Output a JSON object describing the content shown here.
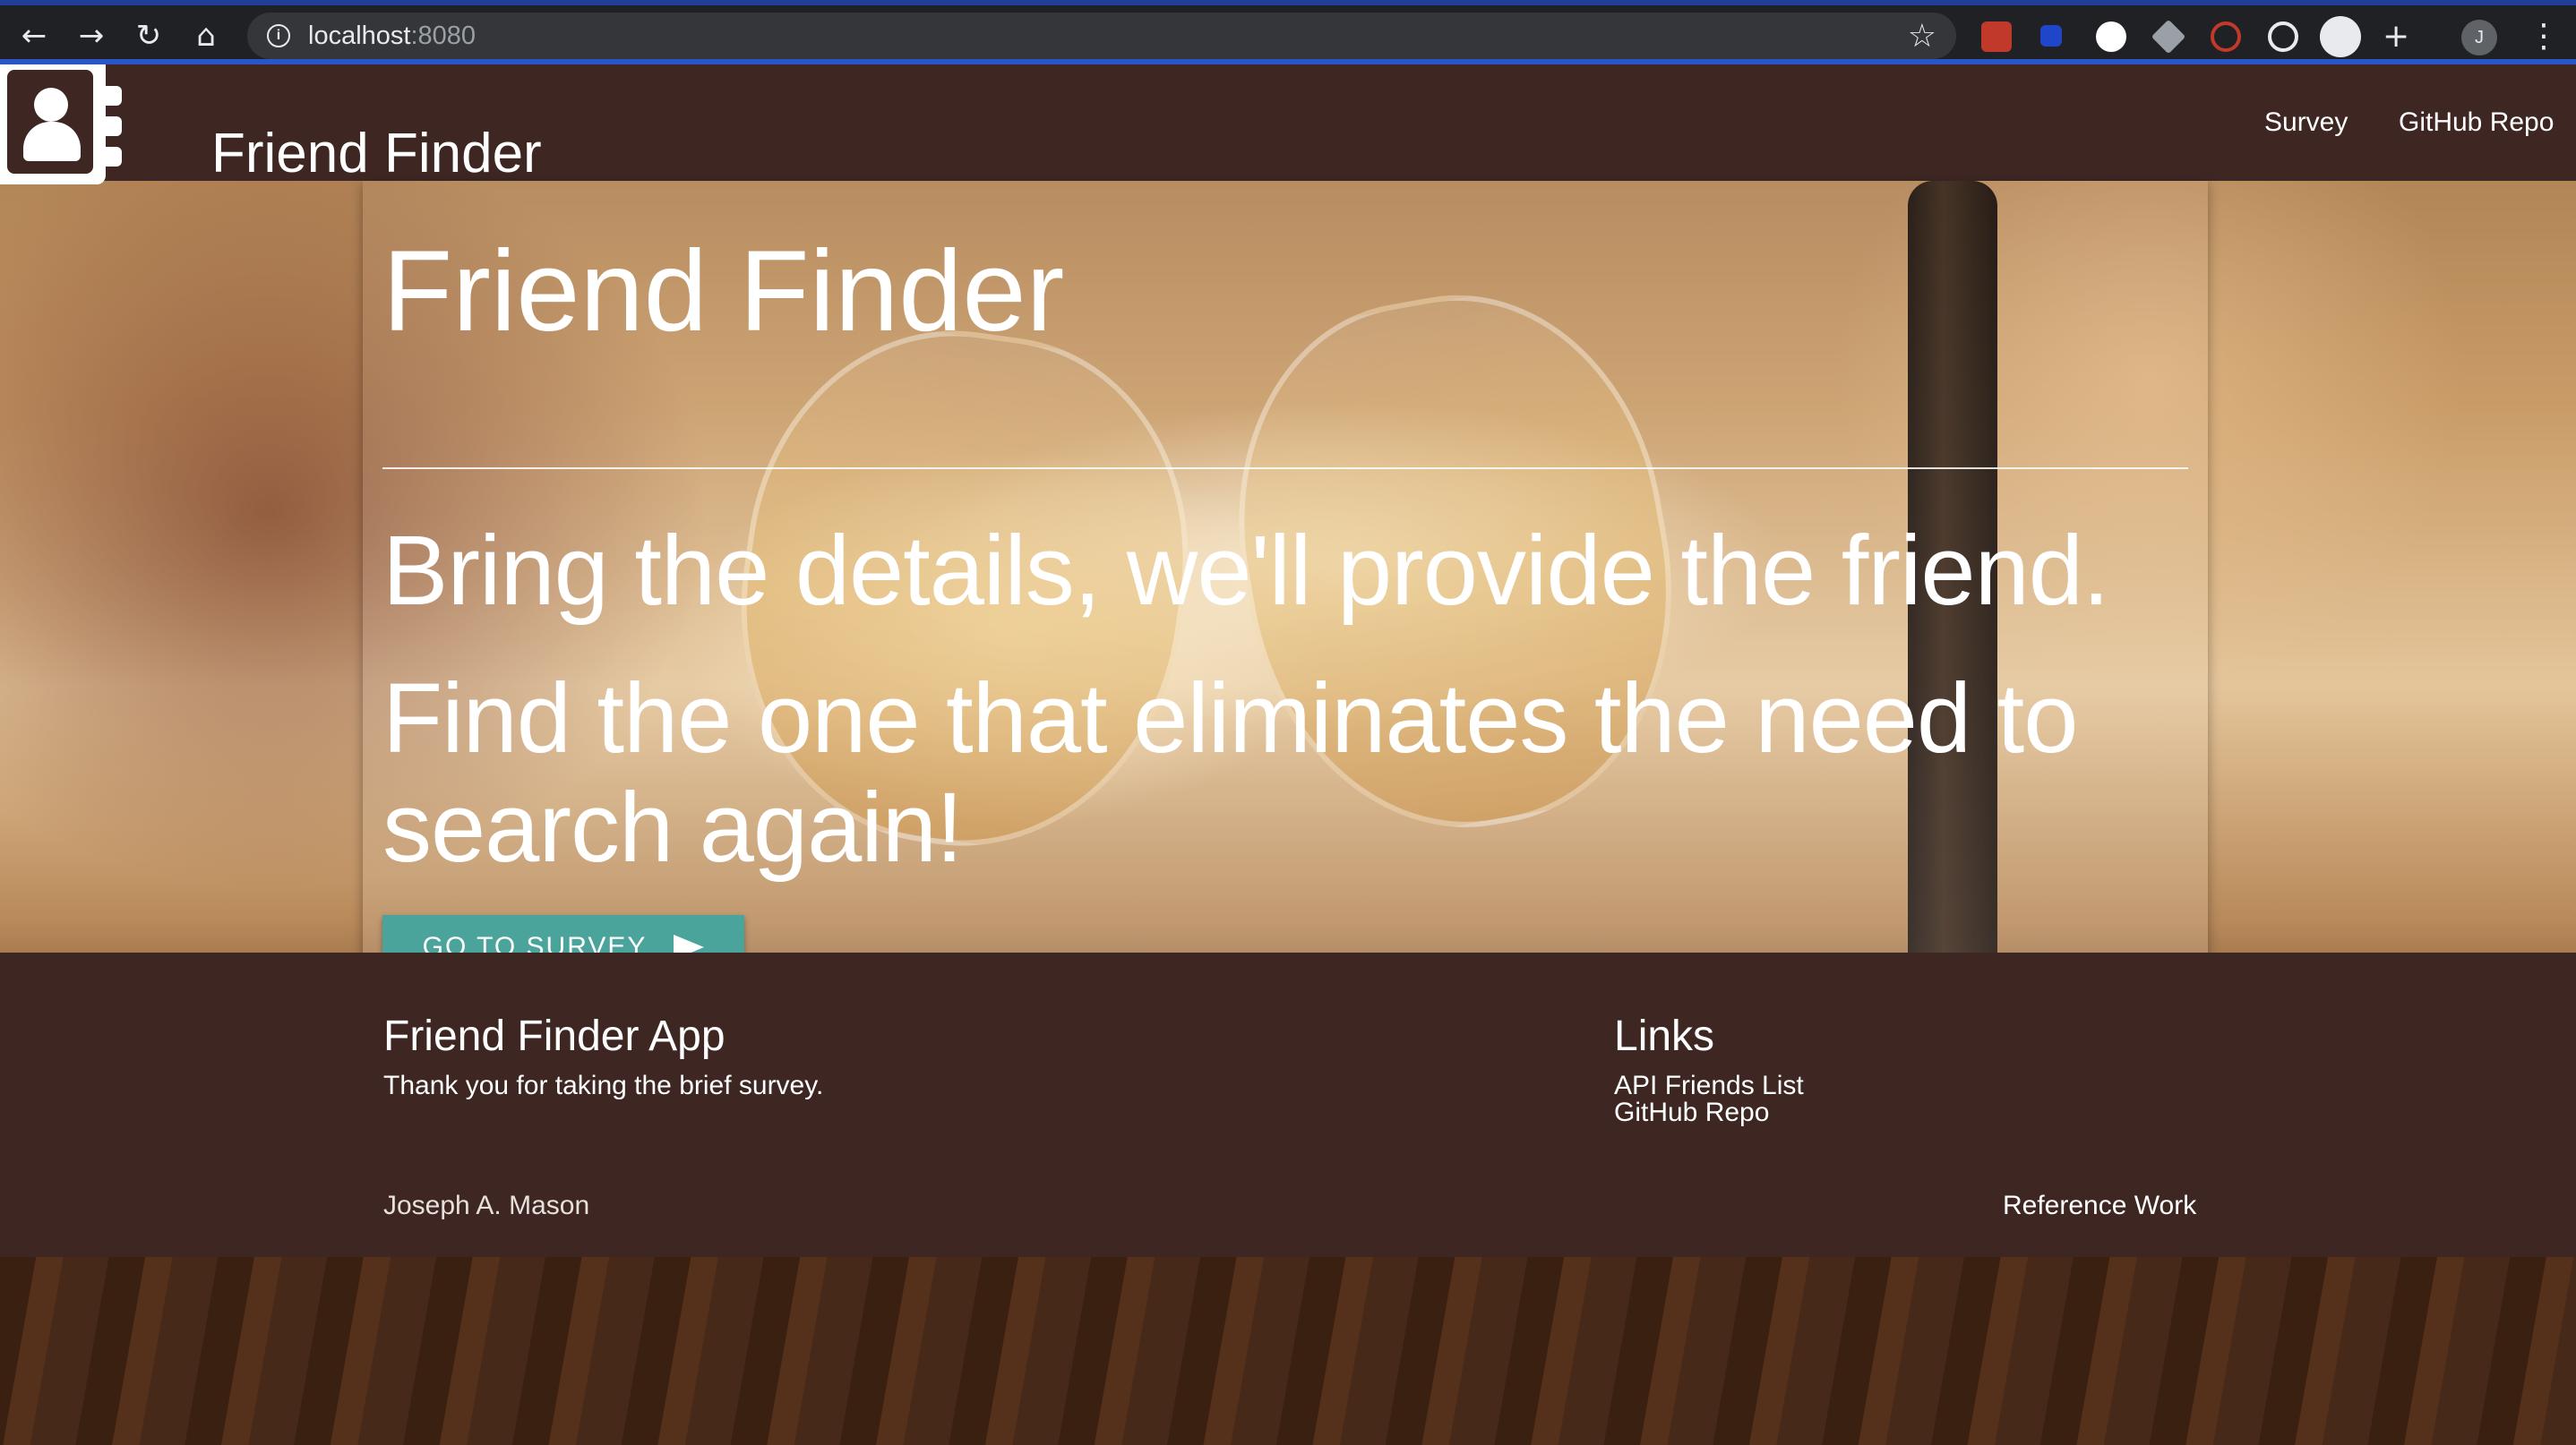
{
  "browser": {
    "url_host": "localhost",
    "url_port": ":8080",
    "profile_initial": "J"
  },
  "header": {
    "brand": "Friend Finder",
    "nav": [
      "Survey",
      "GitHub Repo"
    ]
  },
  "hero": {
    "title": "Friend Finder",
    "tagline": "Bring the details, we'll provide the friend.",
    "subtext": "Find the one that eliminates the need to search again!",
    "button_label": "GO TO SURVEY"
  },
  "footer": {
    "app_title": "Friend Finder App",
    "app_text": "Thank you for taking the brief survey.",
    "links_title": "Links",
    "links": [
      "API Friends List",
      "GitHub Repo"
    ],
    "author": "Joseph A. Mason",
    "reference": "Reference Work"
  },
  "colors": {
    "header_bg": "#3e2723",
    "button_bg": "#4aa49b",
    "chrome_bg": "#202124"
  }
}
